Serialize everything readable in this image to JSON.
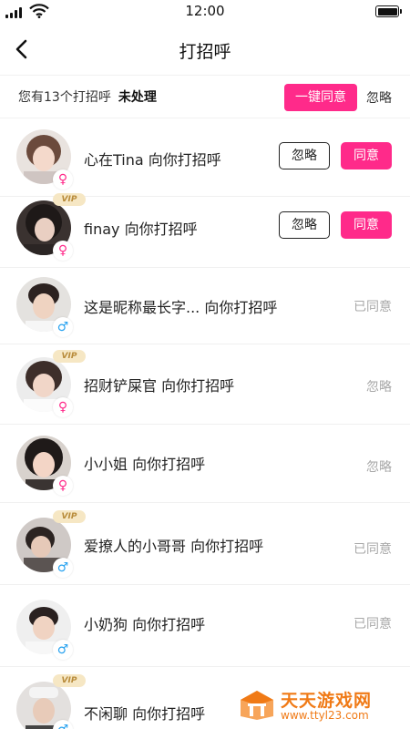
{
  "status_bar": {
    "time": "12:00"
  },
  "nav": {
    "title": "打招呼"
  },
  "summary": {
    "text": "您有13个打招呼",
    "status": "未处理",
    "agree_all": "一键同意",
    "ignore_all": "忽略"
  },
  "rows": [
    {
      "name_text": "心在Tina 向你打招呼",
      "gender": "female",
      "vip": false,
      "state": "pending"
    },
    {
      "name_text": "finay 向你打招呼",
      "gender": "female",
      "vip": true,
      "state": "pending"
    },
    {
      "name_text": "这是昵称最长字... 向你打招呼",
      "gender": "male",
      "vip": false,
      "state": "agreed",
      "status": "已同意"
    },
    {
      "name_text": "招财铲屎官 向你打招呼",
      "gender": "female",
      "vip": true,
      "state": "ignored",
      "status": "忽略"
    },
    {
      "name_text": "小小姐 向你打招呼",
      "gender": "female",
      "vip": false,
      "state": "ignored",
      "status": "忽略"
    },
    {
      "name_text": "爱撩人的小哥哥 向你打招呼",
      "gender": "male",
      "vip": true,
      "state": "agreed",
      "status": "已同意"
    },
    {
      "name_text": "小奶狗 向你打招呼",
      "gender": "male",
      "vip": false,
      "state": "agreed",
      "status": "已同意"
    },
    {
      "name_text": "不闲聊 向你打招呼",
      "gender": "male",
      "vip": true,
      "state": "agreed"
    }
  ],
  "labels": {
    "ignore": "忽略",
    "agree": "同意",
    "vip": "VIP",
    "female_symbol": "♀",
    "male_symbol": "♂"
  },
  "watermark": {
    "title": "天天游戏网",
    "url": "www.ttyl23.com"
  },
  "colors": {
    "accent": "#ff2a8a",
    "male": "#2aa3f0",
    "muted": "#a8a8a8",
    "vip_bg": "#f6e7c4",
    "watermark": "#f07a16"
  },
  "icons": {
    "back": "chevron-left-icon",
    "signal": "signal-icon",
    "wifi": "wifi-icon",
    "battery": "battery-icon"
  }
}
